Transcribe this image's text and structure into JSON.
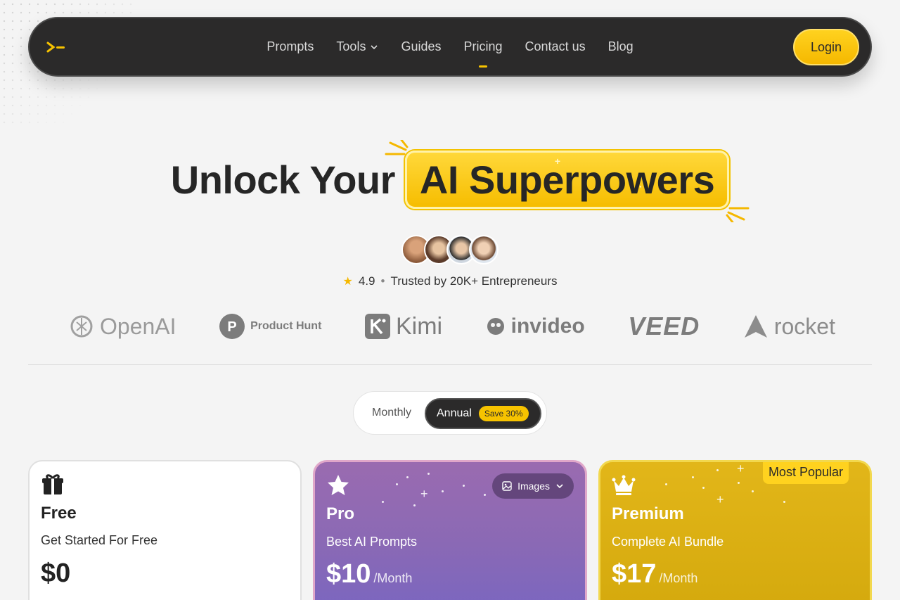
{
  "nav": {
    "items": [
      {
        "label": "Prompts",
        "active": false
      },
      {
        "label": "Tools",
        "active": false,
        "has_dropdown": true
      },
      {
        "label": "Guides",
        "active": false
      },
      {
        "label": "Pricing",
        "active": true
      },
      {
        "label": "Contact us",
        "active": false
      },
      {
        "label": "Blog",
        "active": false
      }
    ],
    "login_label": "Login"
  },
  "hero": {
    "title_plain": "Unlock Your",
    "title_highlight": "AI Superpowers",
    "rating": "4.9",
    "trusted_text": "Trusted by 20K+ Entrepreneurs"
  },
  "logos": {
    "openai": "OpenAI",
    "producthunt": "Product Hunt",
    "kimi": "Kimi",
    "invideo": "invideo",
    "veed": "VEED",
    "rocket": "rocket"
  },
  "billing_toggle": {
    "monthly_label": "Monthly",
    "annual_label": "Annual",
    "save_badge": "Save 30%",
    "selected": "Annual"
  },
  "plans": {
    "free": {
      "name": "Free",
      "subtitle": "Get Started For Free",
      "price": "$0",
      "icon": "gift-icon"
    },
    "pro": {
      "name": "Pro",
      "subtitle": "Best AI Prompts",
      "price": "$10",
      "period": "/Month",
      "filter_label": "Images",
      "icon": "star-icon"
    },
    "premium": {
      "name": "Premium",
      "subtitle": "Complete AI Bundle",
      "price": "$17",
      "period": "/Month",
      "badge": "Most Popular",
      "icon": "crown-icon"
    }
  },
  "colors": {
    "accent": "#f7c300",
    "nav_bg": "#2b2a2a",
    "pro_card": "#8a69b5",
    "premium_card": "#d4a90d"
  }
}
